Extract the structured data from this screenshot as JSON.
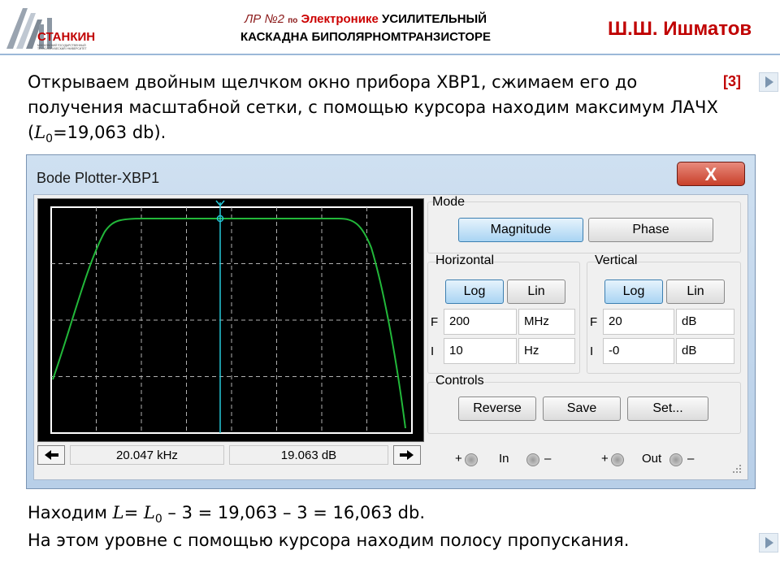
{
  "slide": {
    "logo_text": "СТАНКИН",
    "logo_sub": "МОСКОВСКИЙ ГОСУДАРСТВЕННЫЙ ТЕХНОЛОГИЧЕСКИЙ УНИВЕРСИТЕТ",
    "title_lr": "ЛР №2",
    "title_po": "по",
    "title_subject": "Электронике",
    "title_rest1": "УСИЛИТЕЛЬНЫЙ",
    "title_line2": "КАСКАДНА БИПОЛЯРНОМТРАНЗИСТОРЕ",
    "author": "Ш.Ш. Ишматов",
    "para1": "Открываем двойным щелчком окно прибора XBP1, сжимаем его до получения масштабной сетки, с помощью курсора находим максимум ЛАЧХ (",
    "para1_var": "L",
    "para1_sub": "0",
    "para1_end": "=19,063 db).",
    "ref": "[3]",
    "para2_pre": "Находим ",
    "para2_L": "L",
    "para2_eq": "= ",
    "para2_L0": "L",
    "para2_sub": "0",
    "para2_end": " – 3 = 19,063 – 3 = 16,063 db.",
    "para3": "На этом уровне с помощью курсора находим полосу пропускания."
  },
  "window": {
    "title": "Bode Plotter-XBP1",
    "close_glyph": "X"
  },
  "mode": {
    "label": "Mode",
    "magnitude": "Magnitude",
    "phase": "Phase",
    "selected": "Magnitude"
  },
  "horizontal": {
    "label": "Horizontal",
    "log": "Log",
    "lin": "Lin",
    "selected": "Log",
    "f_label": "F",
    "f_value": "200",
    "f_unit": "MHz",
    "i_label": "I",
    "i_value": "10",
    "i_unit": "Hz"
  },
  "vertical": {
    "label": "Vertical",
    "log": "Log",
    "lin": "Lin",
    "selected": "Log",
    "f_label": "F",
    "f_value": "20",
    "f_unit": "dB",
    "i_label": "I",
    "i_value": "-0",
    "i_unit": "dB"
  },
  "controls": {
    "label": "Controls",
    "reverse": "Reverse",
    "save": "Save",
    "set": "Set..."
  },
  "readout": {
    "left_arrow": "◆",
    "freq": "20.047 kHz",
    "gain": "19.063 dB",
    "right_arrow": "➜"
  },
  "terminals": {
    "plus": "+",
    "minus": "–",
    "in": "In",
    "out": "Out"
  },
  "colors": {
    "curve": "#22b83a",
    "cursor": "#25c8d8",
    "grid": "#b0b0b0",
    "accent_red": "#c00000"
  }
}
